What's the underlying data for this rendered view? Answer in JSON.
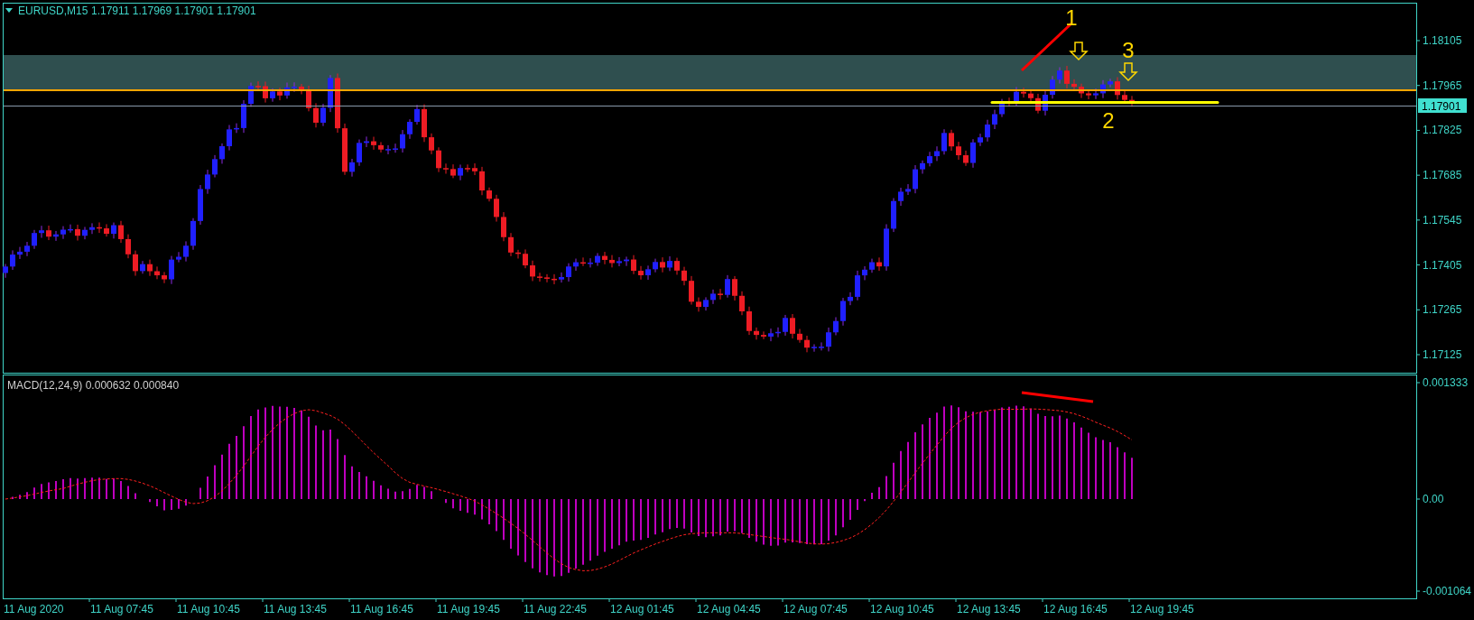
{
  "header": {
    "symbol": "EURUSD,M15",
    "ohlc": "1.17911 1.17969 1.17901 1.17901"
  },
  "price_axis": {
    "ticks": [
      "1.18105",
      "1.17965",
      "1.17825",
      "1.17685",
      "1.17545",
      "1.17405",
      "1.17265",
      "1.17125"
    ],
    "current_price": "1.17901"
  },
  "annotations": [
    "1",
    "2",
    "3"
  ],
  "macd": {
    "label": "MACD(12,24,9) 0.000632 0.000840",
    "ticks": [
      "0.001333",
      "0.00",
      "-0.001064"
    ]
  },
  "time_axis": {
    "labels": [
      "11 Aug 2020",
      "11 Aug 07:45",
      "11 Aug 10:45",
      "11 Aug 13:45",
      "11 Aug 16:45",
      "11 Aug 19:45",
      "11 Aug 22:45",
      "12 Aug 01:45",
      "12 Aug 04:45",
      "12 Aug 07:45",
      "12 Aug 10:45",
      "12 Aug 13:45",
      "12 Aug 16:45",
      "12 Aug 19:45"
    ]
  }
}
